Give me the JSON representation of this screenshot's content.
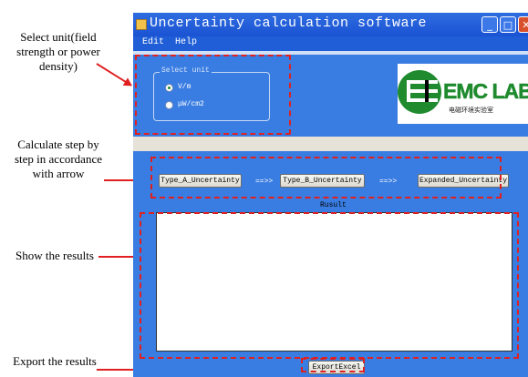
{
  "annotations": {
    "select_unit": "Select unit(field strength or power density)",
    "calculate_step": "Calculate step by step in accordance with arrow",
    "show_results": "Show the results",
    "export_results": "Export the results"
  },
  "window": {
    "title": "Uncertainty calculation software",
    "minimize": "_",
    "maximize": "□",
    "close": "✕"
  },
  "menu": {
    "items": [
      "Edit",
      "Help"
    ]
  },
  "unit_group": {
    "legend": "Select unit",
    "options": [
      {
        "label": "V/m",
        "checked": true
      },
      {
        "label": "μW/cm2",
        "checked": false
      }
    ]
  },
  "logo": {
    "text": "EMC LAB",
    "subtitle": "电磁环境实验室"
  },
  "steps": {
    "type_a": "Type_A_Uncertainty",
    "type_b": "Type_B_Uncertainty",
    "expanded": "Expanded_Uncertainty",
    "arrow": "==>>"
  },
  "result": {
    "label": "Rusult"
  },
  "export": {
    "label": "ExportExcel"
  },
  "colors": {
    "window_bg": "#3a7de2",
    "annotation_red": "#e02020",
    "logo_green": "#1f8b2e"
  }
}
